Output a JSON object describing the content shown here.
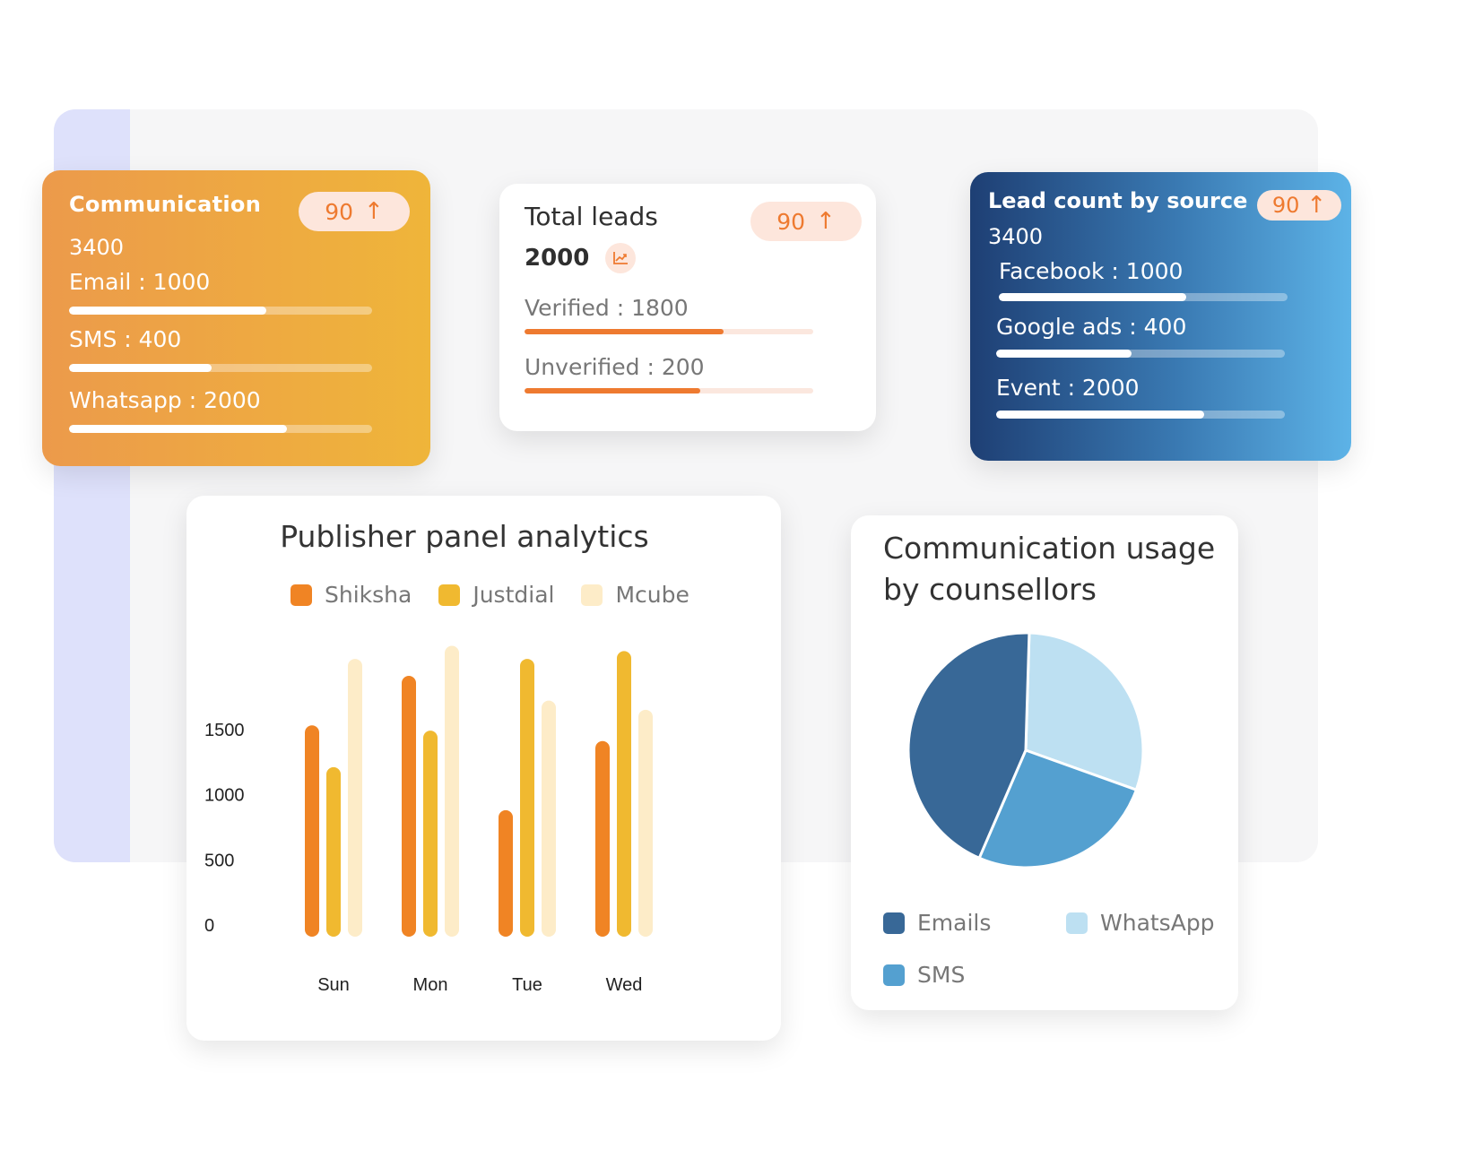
{
  "communication_card": {
    "title": "Communication",
    "total": "3400",
    "badge": {
      "value": "90",
      "icon": "arrow-up-icon",
      "glyph": "↑"
    },
    "metrics": [
      {
        "label": "Email : 1000",
        "progress": 0.65
      },
      {
        "label": "SMS : 400",
        "progress": 0.47
      },
      {
        "label": "Whatsapp : 2000",
        "progress": 0.72
      }
    ]
  },
  "total_leads_card": {
    "title": "Total leads",
    "total": "2000",
    "trend_icon": "trend-chart-icon",
    "badge": {
      "value": "90",
      "icon": "arrow-up-icon",
      "glyph": "↑"
    },
    "metrics": [
      {
        "label": "Verified : 1800",
        "progress": 0.69
      },
      {
        "label": "Unverified : 200",
        "progress": 0.61
      }
    ]
  },
  "lead_source_card": {
    "title": "Lead count by source",
    "total": "3400",
    "badge": {
      "value": "90",
      "icon": "arrow-up-icon",
      "glyph": "↑"
    },
    "metrics": [
      {
        "label": "Facebook : 1000",
        "progress": 0.65
      },
      {
        "label": "Google ads : 400",
        "progress": 0.47
      },
      {
        "label": "Event : 2000",
        "progress": 0.72
      }
    ]
  },
  "colors": {
    "shiksha": "#f08424",
    "justdial": "#f0b930",
    "mcube": "#fdecc8",
    "emails": "#386897",
    "sms": "#54a0d0",
    "whatsapp": "#bde0f2",
    "accent": "#ee7a30"
  },
  "chart_data": [
    {
      "type": "bar",
      "title": "Publisher panel analytics",
      "categories": [
        "Sun",
        "Mon",
        "Tue",
        "Wed"
      ],
      "series": [
        {
          "name": "Shiksha",
          "values": [
            1620,
            2000,
            970,
            1500
          ]
        },
        {
          "name": "Justdial",
          "values": [
            1300,
            1580,
            2130,
            2190
          ]
        },
        {
          "name": "Mcube",
          "values": [
            2130,
            2230,
            1810,
            1740
          ]
        }
      ],
      "yticks": [
        "0",
        "500",
        "1000",
        "1500"
      ],
      "ylim": [
        0,
        2300
      ],
      "xlabel": "",
      "ylabel": "",
      "grid": false,
      "legend": "top-center"
    },
    {
      "type": "pie",
      "title": "Communication usage by counsellors",
      "labels": [
        "WhatsApp",
        "SMS",
        "Emails"
      ],
      "values": [
        30,
        26,
        44
      ],
      "legend_order": [
        "Emails",
        "WhatsApp",
        "SMS"
      ],
      "legend": "bottom"
    }
  ]
}
